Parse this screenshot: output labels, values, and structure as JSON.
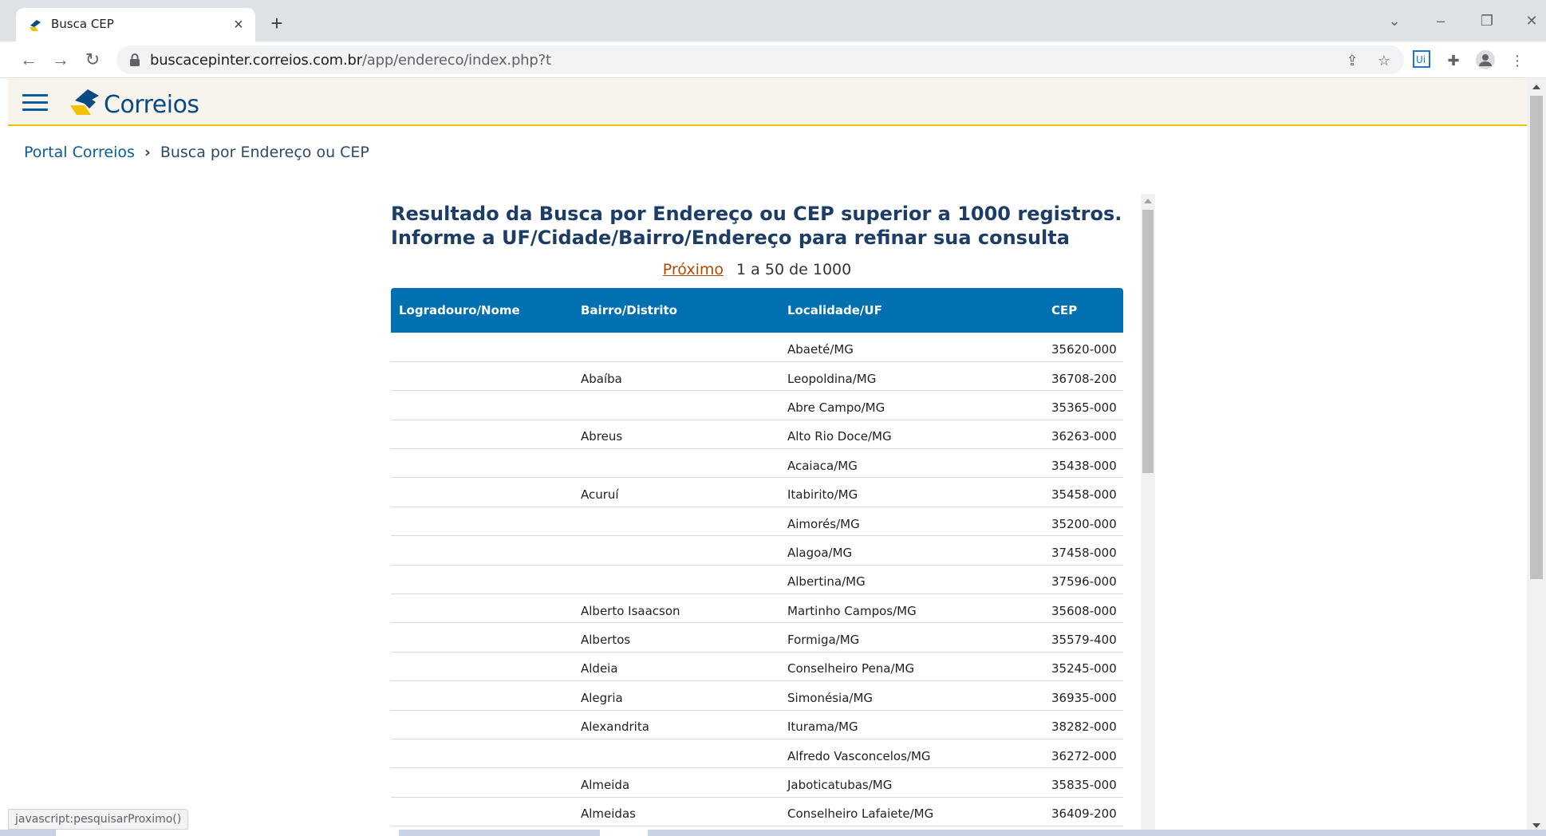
{
  "browser": {
    "tab_title": "Busca CEP",
    "new_tab": "+",
    "url_host": "buscacepinter.correios.com.br",
    "url_path": "/app/endereco/index.php?t",
    "status_url": "javascript:pesquisarProximo()"
  },
  "header": {
    "logo_text": "Correios"
  },
  "breadcrumb": {
    "link": "Portal Correios",
    "separator": "›",
    "current": "Busca por Endereço ou CEP"
  },
  "result": {
    "heading_line1": "Resultado da Busca por Endereço ou CEP superior a 1000 registros.",
    "heading_line2": "Informe a UF/Cidade/Bairro/Endereço para refinar sua consulta",
    "next_label": "Próximo",
    "range_label": "1 a 50 de 1000"
  },
  "table": {
    "headers": [
      "Logradouro/Nome",
      "Bairro/Distrito",
      "Localidade/UF",
      "CEP"
    ],
    "rows": [
      [
        "",
        "",
        "Abaeté/MG",
        "35620-000"
      ],
      [
        "",
        "Abaíba",
        "Leopoldina/MG",
        "36708-200"
      ],
      [
        "",
        "",
        "Abre Campo/MG",
        "35365-000"
      ],
      [
        "",
        "Abreus",
        "Alto Rio Doce/MG",
        "36263-000"
      ],
      [
        "",
        "",
        "Acaiaca/MG",
        "35438-000"
      ],
      [
        "",
        "Acuruí",
        "Itabirito/MG",
        "35458-000"
      ],
      [
        "",
        "",
        "Aimorés/MG",
        "35200-000"
      ],
      [
        "",
        "",
        "Alagoa/MG",
        "37458-000"
      ],
      [
        "",
        "",
        "Albertina/MG",
        "37596-000"
      ],
      [
        "",
        "Alberto Isaacson",
        "Martinho Campos/MG",
        "35608-000"
      ],
      [
        "",
        "Albertos",
        "Formiga/MG",
        "35579-400"
      ],
      [
        "",
        "Aldeia",
        "Conselheiro Pena/MG",
        "35245-000"
      ],
      [
        "",
        "Alegria",
        "Simonésia/MG",
        "36935-000"
      ],
      [
        "",
        "Alexandrita",
        "Iturama/MG",
        "38282-000"
      ],
      [
        "",
        "",
        "Alfredo Vasconcelos/MG",
        "36272-000"
      ],
      [
        "",
        "Almeida",
        "Jaboticatubas/MG",
        "35835-000"
      ],
      [
        "",
        "Almeidas",
        "Conselheiro Lafaiete/MG",
        "36409-200"
      ]
    ]
  },
  "colors": {
    "table_header": "#0070b0",
    "heading": "#1d3d66",
    "brand_blue": "#0a4a84",
    "brand_yellow": "#f2c200",
    "next_link": "#b04a00"
  }
}
